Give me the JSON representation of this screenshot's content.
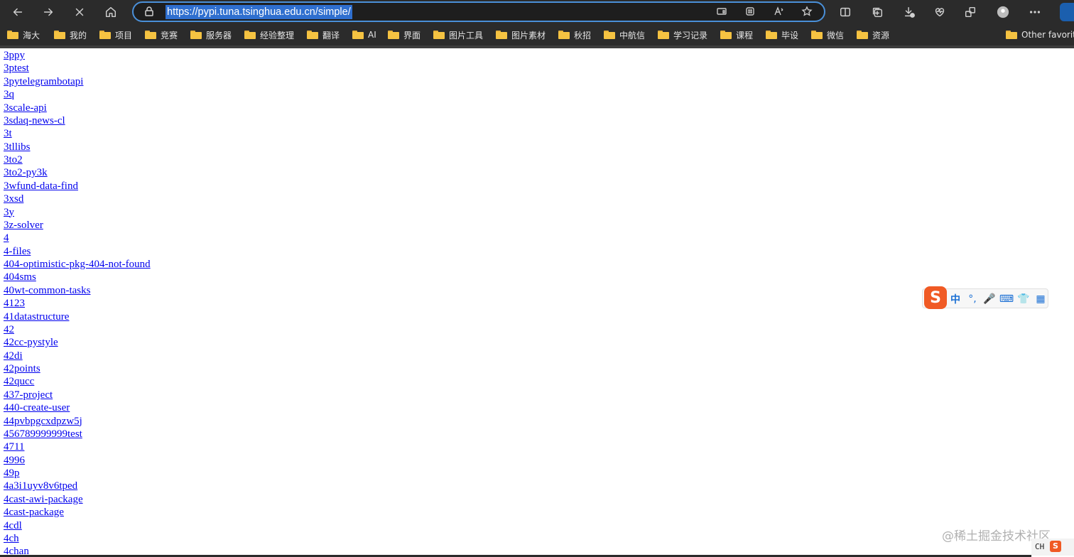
{
  "browser": {
    "url": "https://pypi.tuna.tsinghua.edu.cn/simple/",
    "nav": [
      "back-icon",
      "forward-icon",
      "stop-icon",
      "home-icon"
    ],
    "right_icons": [
      "split-screen-icon",
      "collections-icon",
      "downloads-icon",
      "health-icon",
      "extensions-icon",
      "profile-icon",
      "more-icon"
    ],
    "bookmarks": [
      "海大",
      "我的",
      "项目",
      "竞赛",
      "服务器",
      "经验整理",
      "翻译",
      "AI",
      "界面",
      "图片工具",
      "图片素材",
      "秋招",
      "中航信",
      "学习记录",
      "课程",
      "毕设",
      "微信",
      "资源"
    ],
    "other_favorites": "Other favorite"
  },
  "packages": [
    "3ppy",
    "3ptest",
    "3pytelegrambotapi",
    "3q",
    "3scale-api",
    "3sdaq-news-cl",
    "3t",
    "3tllibs",
    "3to2",
    "3to2-py3k",
    "3wfund-data-find",
    "3xsd",
    "3y",
    "3z-solver",
    "4",
    "4-files",
    "404-optimistic-pkg-404-not-found",
    "404sms",
    "40wt-common-tasks",
    "4123",
    "41datastructure",
    "42",
    "42cc-pystyle",
    "42di",
    "42points",
    "42qucc",
    "437-project",
    "440-create-user",
    "44pvbpgcxdpzw5j",
    "456789999999test",
    "4711",
    "4996",
    "49p",
    "4a3i1uyv8v6tped",
    "4cast-awi-package",
    "4cast-package",
    "4cdl",
    "4ch",
    "4chan"
  ],
  "ime": {
    "logo": "S",
    "items": [
      "中",
      "°,",
      "🎤",
      "⌨",
      "👕",
      "▦"
    ]
  },
  "watermark": "@稀土掘金技术社区",
  "tray": {
    "lang": "CH",
    "logo": "S"
  }
}
